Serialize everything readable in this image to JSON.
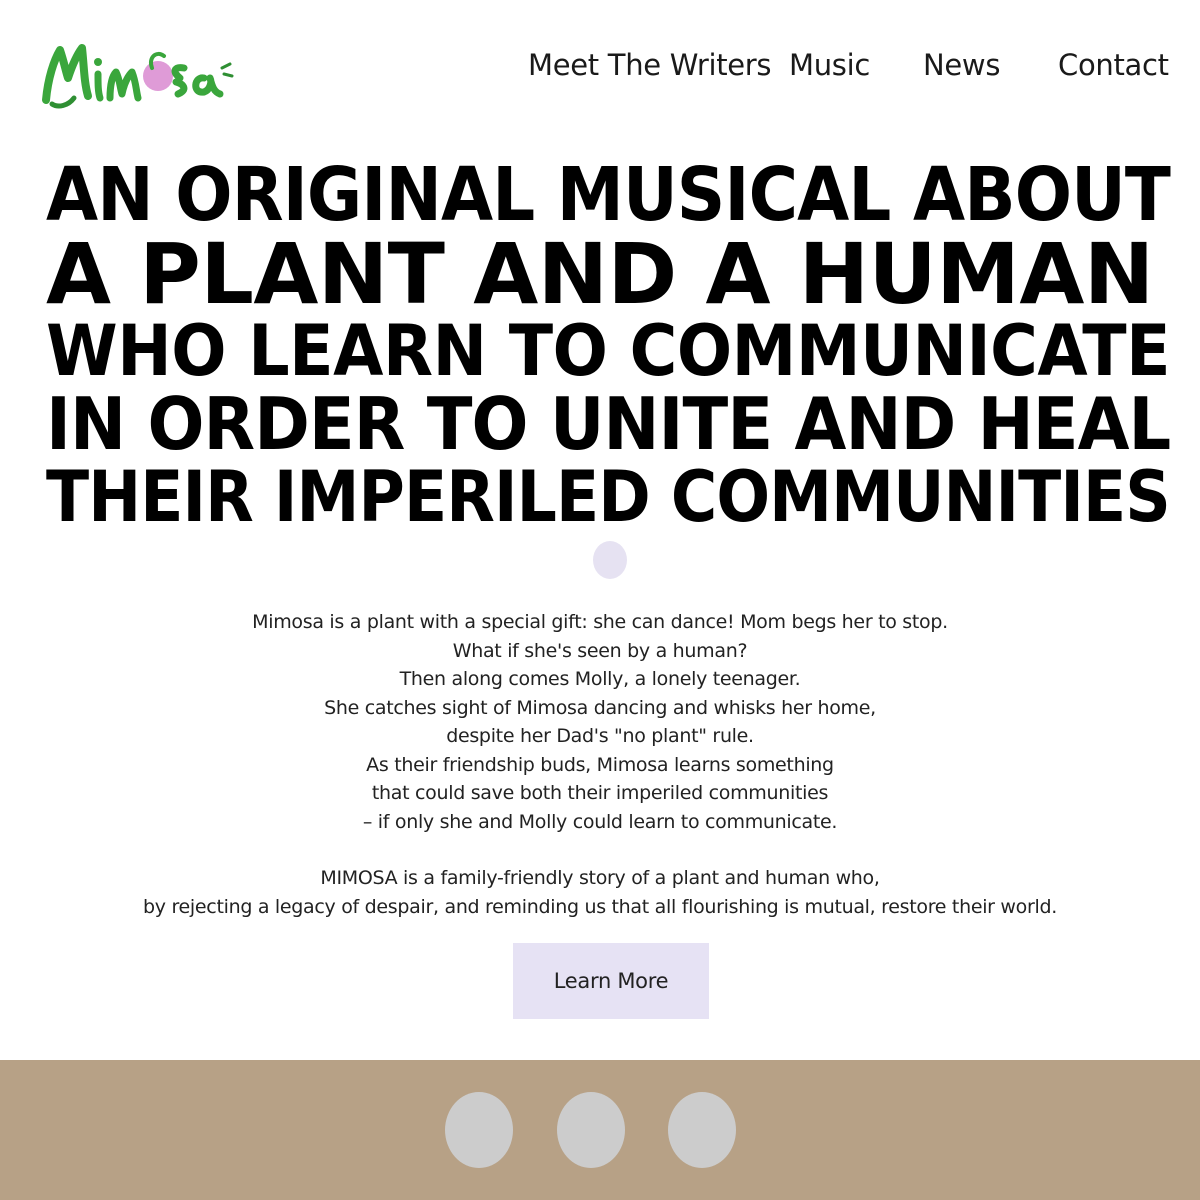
{
  "header": {
    "logo_text": "Mimosa",
    "nav": [
      {
        "label": "Meet The Writers"
      },
      {
        "label": "Music"
      },
      {
        "label": "News"
      },
      {
        "label": "Contact"
      }
    ]
  },
  "hero": {
    "headline_lines": [
      "AN ORIGINAL MUSICAL ABOUT",
      "A PLANT AND A HUMAN",
      "WHO LEARN TO COMMUNICATE",
      "IN ORDER TO UNITE AND HEAL",
      "THEIR IMPERILED COMMUNITIES"
    ]
  },
  "story": {
    "paragraph1": [
      "Mimosa is a plant with a special gift: she can dance! Mom begs her to stop.",
      "What if she's seen by a human?",
      "Then along comes Molly, a lonely teenager.",
      "She catches sight of Mimosa dancing and whisks her home,",
      "despite her Dad's \"no plant\" rule.",
      "As their friendship buds, Mimosa learns something",
      "that could save both their imperiled communities",
      "– if only she and Molly could learn to communicate."
    ],
    "paragraph2": [
      "MIMOSA is a family-friendly story of a plant and human who,",
      "by rejecting a legacy of despair, and reminding us that all flourishing is mutual, restore their world."
    ]
  },
  "cta": {
    "label": "Learn More"
  },
  "colors": {
    "accent_lavender": "#e6e2f4",
    "footer_band": "#b7a186",
    "social_placeholder": "#cccccc",
    "logo_green": "#3aa63c",
    "logo_pink": "#d98ad0"
  },
  "footer": {
    "social_icons": [
      "social-icon-1",
      "social-icon-2",
      "social-icon-3"
    ]
  }
}
